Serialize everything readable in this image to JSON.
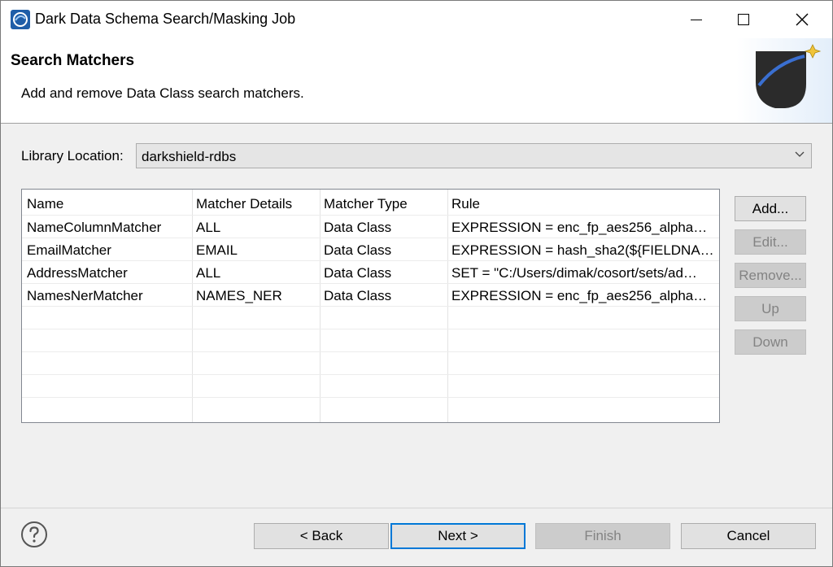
{
  "window": {
    "title": "Dark Data Schema Search/Masking Job"
  },
  "banner": {
    "title": "Search Matchers",
    "description": "Add and remove Data Class search matchers."
  },
  "library": {
    "label": "Library Location:",
    "value": "darkshield-rdbs"
  },
  "table": {
    "columns": [
      "Name",
      "Matcher Details",
      "Matcher Type",
      "Rule"
    ],
    "rows": [
      [
        "NameColumnMatcher",
        "ALL",
        "Data Class",
        "EXPRESSION = enc_fp_aes256_alpha…"
      ],
      [
        "EmailMatcher",
        "EMAIL",
        "Data Class",
        "EXPRESSION = hash_sha2(${FIELDNA…"
      ],
      [
        "AddressMatcher",
        "ALL",
        "Data Class",
        "SET = \"C:/Users/dimak/cosort/sets/ad…"
      ],
      [
        "NamesNerMatcher",
        "NAMES_NER",
        "Data Class",
        "EXPRESSION = enc_fp_aes256_alpha…"
      ]
    ]
  },
  "side_buttons": {
    "add": "Add...",
    "edit": "Edit...",
    "remove": "Remove...",
    "up": "Up",
    "down": "Down"
  },
  "footer": {
    "back": "< Back",
    "next": "Next >",
    "finish": "Finish",
    "cancel": "Cancel"
  },
  "icons": {
    "app": "app-logo-icon",
    "minimize": "minimize-icon",
    "maximize": "maximize-icon",
    "close": "close-icon",
    "help": "help-icon",
    "dropdown": "chevron-down-icon",
    "banner": "wizard-banner-icon"
  },
  "colors": {
    "accent": "#0078d7",
    "disabled_text": "#838383"
  }
}
